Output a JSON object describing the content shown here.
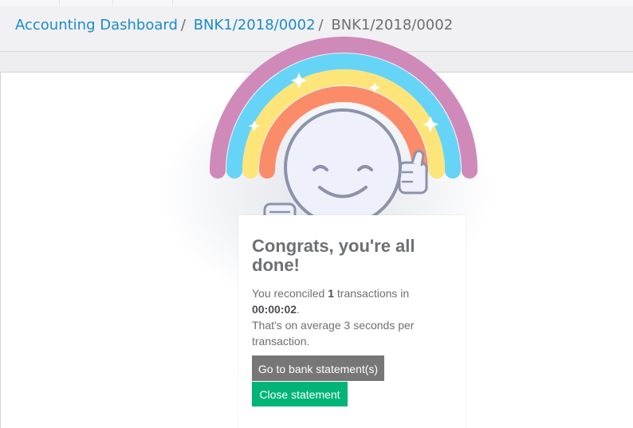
{
  "breadcrumb": {
    "items": [
      {
        "label": "Accounting Dashboard",
        "link": true
      },
      {
        "label": "BNK1/2018/0002",
        "link": true
      },
      {
        "label": "BNK1/2018/0002",
        "link": false
      }
    ],
    "separator": "/"
  },
  "reconciliation": {
    "title": "Congrats, you're all done!",
    "line1_prefix": "You reconciled ",
    "transactions_count": "1",
    "line1_suffix": " transactions in",
    "duration": "00:00:02",
    "period": ".",
    "average_text": "That's on average 3 seconds per transaction.",
    "goto_button": "Go to bank statement(s)",
    "close_button": "Close statement"
  },
  "colors": {
    "link": "#1a8ccb",
    "text": "#6d6f73",
    "button_secondary": "#777777",
    "button_primary": "#00b478",
    "rainbow": [
      "#cf8ab9",
      "#66d4f7",
      "#fde57a",
      "#fb8c6a"
    ]
  },
  "icons": [
    "rainbow-illustration",
    "smiley-face-icon",
    "thumbs-up-icon",
    "pointing-hand-icon",
    "sparkle-icon"
  ]
}
